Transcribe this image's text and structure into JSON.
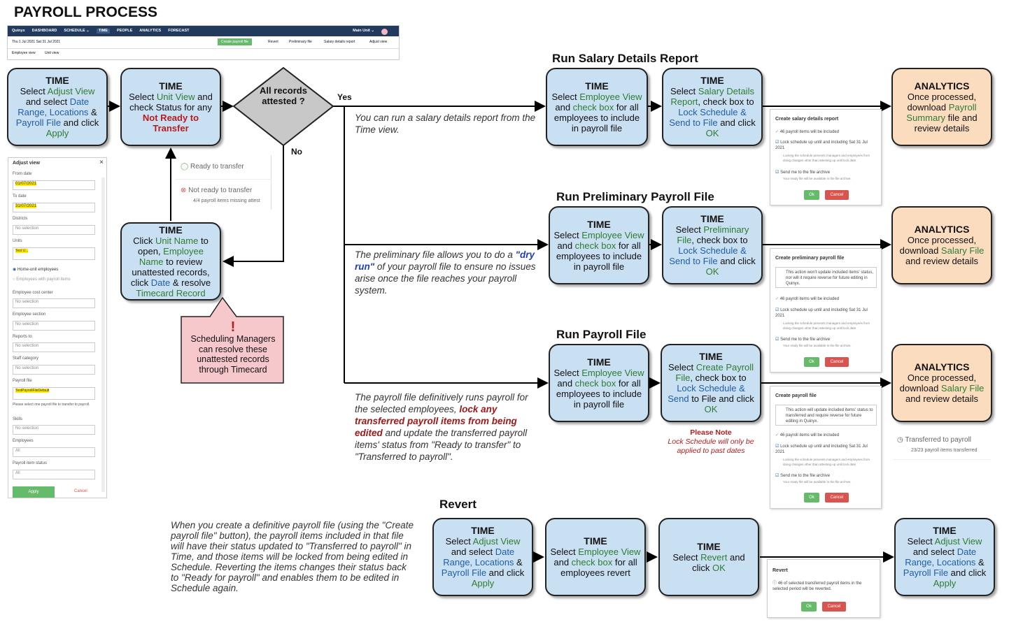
{
  "title": "PAYROLL PROCESS",
  "nav": {
    "brand": "Quinyx",
    "items": [
      "DASHBOARD",
      "SCHEDULE ⌄",
      "TIME",
      "PEOPLE",
      "ANALYTICS",
      "FORECAST"
    ],
    "unit": "Main Unit ⌄",
    "daterange": "Thu 1 Jul 2021   Sat 31 Jul 2021",
    "create": "Create payroll file",
    "actions": [
      "Revert",
      "Preliminary file",
      "Salary details report",
      "Adjust view"
    ],
    "views": [
      "Employee view",
      "Unit view"
    ]
  },
  "s1": {
    "h": "TIME",
    "p1": "Select ",
    "l1": "Adjust View",
    "p2": " and select ",
    "l2": "Date Range, Locations",
    "p3": " & ",
    "l3": "Payroll File",
    "p4": " and click ",
    "l4": "Apply"
  },
  "s2": {
    "h": "TIME",
    "p1": "Select ",
    "l1": "Unit View",
    "p2": " and check Status for any ",
    "l2": "Not Ready to Transfer"
  },
  "dec": {
    "text": "All records attested ?",
    "yes": "Yes",
    "no": "No"
  },
  "s3": {
    "h": "TIME",
    "p1": "Click ",
    "l1": "Unit Name",
    "p2": " to open, ",
    "l2": "Employee Name",
    "p3": " to review unattested records, click ",
    "l3": "Date",
    "p4": " & resolve ",
    "l4": "Timecard Record"
  },
  "note": {
    "mark": "!",
    "text": "Scheduling Managers can resolve these unattested  records through Timecard"
  },
  "status": {
    "ready": "Ready to transfer",
    "notready": "Not ready to transfer",
    "missing": "4/4 payroll items missing attest"
  },
  "adjust": {
    "title": "Adjust view",
    "from_l": "From date",
    "from": "01/07/2021",
    "to_l": "To date",
    "to": "31/07/2021",
    "districts": "Districts",
    "nosel": "No selection",
    "units": "Units",
    "unitval": "Test U...",
    "radio1": "Home-unit employees",
    "radio2": "Employees with payroll items",
    "costc": "Employee cost center",
    "section": "Employee section",
    "reports": "Reports to",
    "staff": "Staff category",
    "pfile": "Payroll file",
    "pfileval": "TestPayrollFileDefault",
    "pfilehint": "Please select one payroll file to transfer to payroll.",
    "skills": "Skills",
    "emps": "Employees",
    "all": "All",
    "pistatus": "Payroll item status",
    "apply": "Apply",
    "cancel": "Cancel"
  },
  "sal": {
    "heading": "Run Salary Details Report",
    "italic": "You can run a salary details report from the Time view.",
    "b1": {
      "h": "TIME",
      "p1": "Select ",
      "l1": "Employee View",
      "p2": " and ",
      "l2": "check box",
      "p3": " for all employees to include in payroll file"
    },
    "b2": {
      "h": "TIME",
      "p1": "Select ",
      "l1": "Salary Details Report",
      "p2": ", check box to ",
      "l2": "Lock Schedule & Send to File",
      "p3": " and click ",
      "l3": "OK"
    },
    "b3": {
      "h": "ANALYTICS",
      "p1": "Once processed, download ",
      "l1": "Payroll Summary",
      "p2": " file and review details"
    },
    "dlg": {
      "title": "Create salary details report",
      "items": "46 payroll items will be included",
      "lock": "Lock schedule up until and including Sat 31 Jul 2021",
      "lockhint": "Locking the schedule prevents managers and employees from doing changes other than attesting up until lock date",
      "send": "Send me to the file archive",
      "sendhint": "Your ready file will be available in the file archive.",
      "ok": "Ok",
      "cancel": "Cancel"
    }
  },
  "pre": {
    "heading": "Run Preliminary Payroll File",
    "i1": "The preliminary file allows you to do a ",
    "i2": "\"dry run\"",
    "i3": " of your payroll file to ensure no issues arise once the file reaches your payroll system.",
    "b1": {
      "h": "TIME",
      "p1": "Select ",
      "l1": "Employee View",
      "p2": " and ",
      "l2": "check box",
      "p3": " for all employees to include in payroll file"
    },
    "b2": {
      "h": "TIME",
      "p1": "Select ",
      "l1": "Preliminary File",
      "p2": ", check box to ",
      "l2": "Lock Schedule & Send to File",
      "p3": " and click ",
      "l3": "OK"
    },
    "b3": {
      "h": "ANALYTICS",
      "p1": "Once processed, download ",
      "l1": "Salary File",
      "p2": " and review details"
    },
    "dlg": {
      "title": "Create preliminary payroll file",
      "info": "This action won't update included items' status, nor will it require reverse for future editing in Quinyx.",
      "items": "46 payroll items will be included",
      "lock": "Lock schedule up until and including Sat 31 Jul 2021",
      "lockhint": "Locking the schedule prevents managers and employees from doing changes other than attesting up until lock date",
      "send": "Send me to the file archive",
      "sendhint": "Your ready file will be available in the file archive.",
      "ok": "Ok",
      "cancel": "Cancel"
    }
  },
  "pay": {
    "heading": "Run Payroll File",
    "i1": "The payroll file definitively runs payroll for the selected employees, ",
    "i2": "lock any transferred payroll items from being edited",
    "i3": " and update the transferred payroll items' status from \"Ready to transfer\" to \"Transferred to payroll\".",
    "b1": {
      "h": "TIME",
      "p1": "Select ",
      "l1": "Employee View",
      "p2": " and ",
      "l2": "check box",
      "p3": " for all employees to include in payroll file"
    },
    "b2": {
      "h": "TIME",
      "p1": "Select ",
      "l1": "Create Payroll File",
      "p2": ", check box to ",
      "l2": "Lock Schedule & Send",
      "p3": " to File and click ",
      "l3": "OK"
    },
    "b3": {
      "h": "ANALYTICS",
      "p1": "Once processed, download ",
      "l1": "Salary File",
      "p2": " and review details"
    },
    "pn": "Please Note",
    "pn2": "Lock Schedule will only be applied to past dates",
    "transferred": "Transferred to payroll",
    "transferred2": "23/23 payroll items transferred",
    "dlg": {
      "title": "Create payroll file",
      "info": "This action will update included items' status to transferred and require reverse for future editing in Quinyx.",
      "items": "46 payroll items will be included",
      "lock": "Lock schedule up until and including Sat 31 Jul 2021",
      "lockhint": "Locking the schedule prevents managers and employees from doing changes other than attesting up until lock date",
      "send": "Send me to the file archive",
      "sendhint": "Your ready file will be available in the file archive.",
      "ok": "Ok",
      "cancel": "Cancel"
    }
  },
  "rev": {
    "heading": "Revert",
    "italic": "When you create a definitive payroll file (using the \"Create payroll file\" button), the payroll items included in that file will have their status updated to \"Transferred to payroll\" in Time, and those items will be locked from being edited in Schedule. Reverting the items changes their status back to \"Ready for payroll\" and enables them to be edited in Schedule again.",
    "b1": {
      "h": "TIME",
      "p1": "Select ",
      "l1": "Adjust View",
      "p2": " and select ",
      "l2": "Date Range, Locations",
      "p3": " & ",
      "l3": "Payroll File",
      "p4": " and click ",
      "l4": "Apply"
    },
    "b2": {
      "h": "TIME",
      "p1": "Select ",
      "l1": "Employee View",
      "p2": " and ",
      "l2": "check box",
      "p3": " for all employees revert"
    },
    "b3": {
      "h": "TIME",
      "p1": "Select ",
      "l1": "Revert",
      "p2": " and click ",
      "l2": "OK"
    },
    "b4": {
      "h": "TIME",
      "p1": "Select ",
      "l1": "Adjust View",
      "p2": " and select ",
      "l2": "Date Range, Locations",
      "p3": " & ",
      "l3": "Payroll File",
      "p4": " and click ",
      "l4": "Apply"
    },
    "dlg": {
      "title": "Revert",
      "text": "46 of selected transferred payroll items in the selected period will be reverted.",
      "ok": "Ok",
      "cancel": "Cancel"
    }
  }
}
